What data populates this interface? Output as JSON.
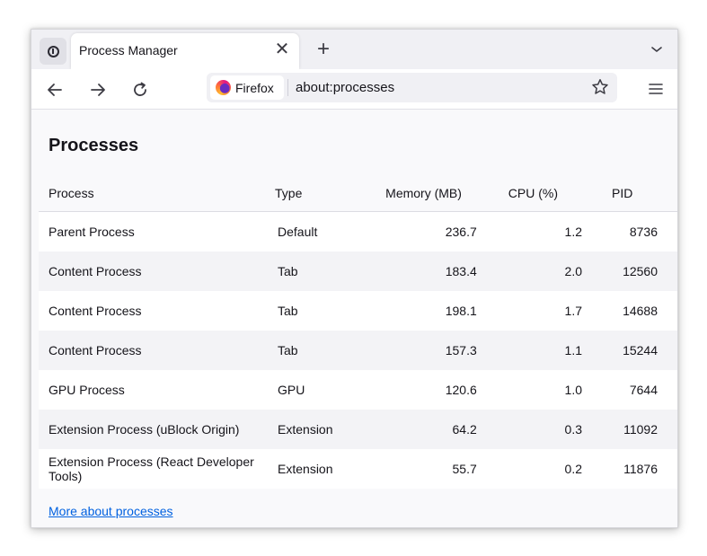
{
  "tab": {
    "title": "Process Manager",
    "close": "✕",
    "new_tab": "+"
  },
  "navbar": {
    "identity_label": "Firefox",
    "url": "about:processes"
  },
  "page": {
    "title": "Processes",
    "columns": {
      "process": "Process",
      "type": "Type",
      "memory": "Memory (MB)",
      "cpu": "CPU (%)",
      "pid": "PID"
    },
    "rows": [
      {
        "process": "Parent Process",
        "type": "Default",
        "memory": "236.7",
        "cpu": "1.2",
        "pid": "8736"
      },
      {
        "process": "Content Process",
        "type": "Tab",
        "memory": "183.4",
        "cpu": "2.0",
        "pid": "12560"
      },
      {
        "process": "Content Process",
        "type": "Tab",
        "memory": "198.1",
        "cpu": "1.7",
        "pid": "14688"
      },
      {
        "process": "Content Process",
        "type": "Tab",
        "memory": "157.3",
        "cpu": "1.1",
        "pid": "15244"
      },
      {
        "process": "GPU Process",
        "type": "GPU",
        "memory": "120.6",
        "cpu": "1.0",
        "pid": "7644"
      },
      {
        "process": "Extension Process (uBlock Origin)",
        "type": "Extension",
        "memory": "64.2",
        "cpu": "0.3",
        "pid": "11092"
      },
      {
        "process": "Extension Process (React Developer Tools)",
        "type": "Extension",
        "memory": "55.7",
        "cpu": "0.2",
        "pid": "11876"
      }
    ],
    "more_link": "More about processes"
  },
  "icons": {
    "site_info": "info-icon",
    "back": "arrow-left-icon",
    "forward": "arrow-right-icon",
    "reload": "reload-icon",
    "bookmark": "star-icon",
    "menu": "hamburger-menu-icon",
    "tab_list": "chevron-down-icon",
    "browser_logo": "firefox-logo-icon"
  },
  "colors": {
    "link": "#0061e0",
    "row_alt": "#f3f3f6"
  }
}
